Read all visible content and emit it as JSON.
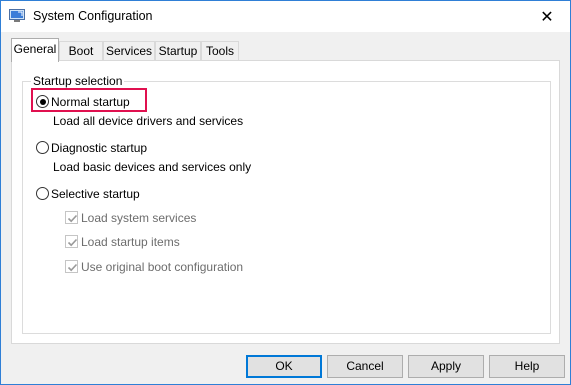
{
  "window": {
    "title": "System Configuration",
    "close_glyph": "✕",
    "app_icon": "msconfig-icon"
  },
  "tabs": [
    {
      "label": "General",
      "active": true
    },
    {
      "label": "Boot",
      "active": false
    },
    {
      "label": "Services",
      "active": false
    },
    {
      "label": "Startup",
      "active": false
    },
    {
      "label": "Tools",
      "active": false
    }
  ],
  "startup_selection": {
    "group_label": "Startup selection",
    "options": [
      {
        "label": "Normal startup",
        "description": "Load all device drivers and services",
        "selected": true
      },
      {
        "label": "Diagnostic startup",
        "description": "Load basic devices and services only",
        "selected": false
      },
      {
        "label": "Selective startup",
        "description": "",
        "selected": false
      }
    ],
    "selective_items": [
      {
        "label": "Load system services",
        "checked": true,
        "enabled": false
      },
      {
        "label": "Load startup items",
        "checked": true,
        "enabled": false
      },
      {
        "label": "Use original boot configuration",
        "checked": true,
        "enabled": false
      }
    ]
  },
  "buttons": {
    "ok": "OK",
    "cancel": "Cancel",
    "apply": "Apply",
    "help": "Help"
  },
  "colors": {
    "highlight": "#e0104f",
    "focus_border": "#0078d7",
    "window_border": "#2f7fd6"
  }
}
